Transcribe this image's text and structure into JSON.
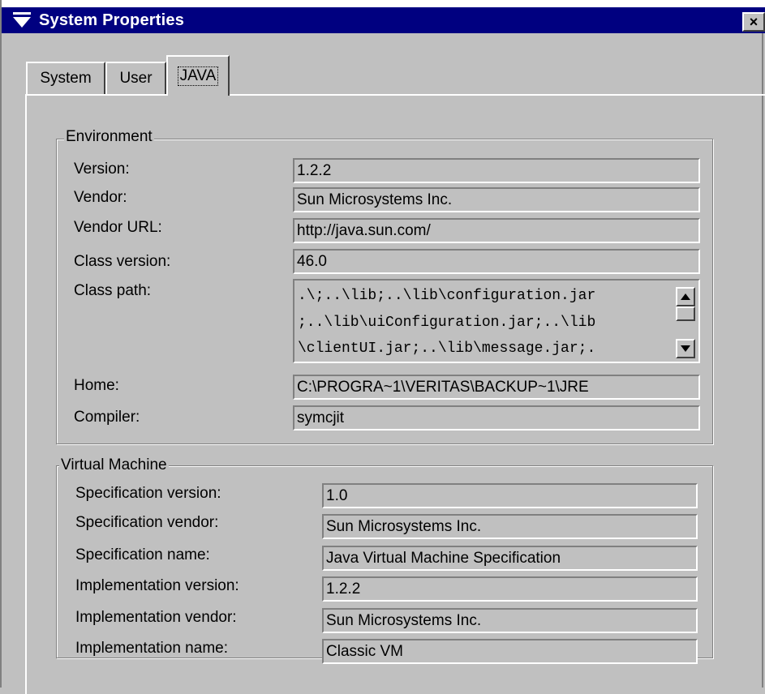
{
  "window": {
    "title": "System Properties",
    "close_label": "×"
  },
  "tabs": [
    {
      "label": "System"
    },
    {
      "label": "User"
    },
    {
      "label": "JAVA"
    }
  ],
  "environment": {
    "label": "Environment",
    "rows": [
      {
        "label": "Version:",
        "value": "1.2.2"
      },
      {
        "label": "Vendor:",
        "value": "Sun Microsystems Inc."
      },
      {
        "label": "Vendor URL:",
        "value": "http://java.sun.com/"
      },
      {
        "label": "Class version:",
        "value": "46.0"
      }
    ],
    "class_path": {
      "label": "Class path:",
      "lines": [
        ".\\;..\\lib;..\\lib\\configuration.jar",
        ";..\\lib\\uiConfiguration.jar;..\\lib",
        "\\clientUI.jar;..\\lib\\message.jar;."
      ]
    },
    "home": {
      "label": "Home:",
      "value": "C:\\PROGRA~1\\VERITAS\\BACKUP~1\\JRE"
    },
    "compiler": {
      "label": "Compiler:",
      "value": "symcjit"
    }
  },
  "vm": {
    "label": "Virtual Machine",
    "rows": [
      {
        "label": "Specification version:",
        "value": "1.0"
      },
      {
        "label": "Specification vendor:",
        "value": "Sun Microsystems Inc."
      },
      {
        "label": "Specification name:",
        "value": "Java Virtual Machine Specification"
      },
      {
        "label": "Implementation version:",
        "value": "1.2.2"
      },
      {
        "label": "Implementation vendor:",
        "value": "Sun Microsystems Inc."
      },
      {
        "label": "Implementation name:",
        "value": "Classic VM"
      }
    ]
  },
  "icons": {
    "window_menu": "window-menu-icon",
    "close": "close-icon",
    "scroll_up": "scroll-up-icon",
    "scroll_down": "scroll-down-icon"
  },
  "colors": {
    "titlebar": "#000080",
    "face": "#c0c0c0"
  }
}
